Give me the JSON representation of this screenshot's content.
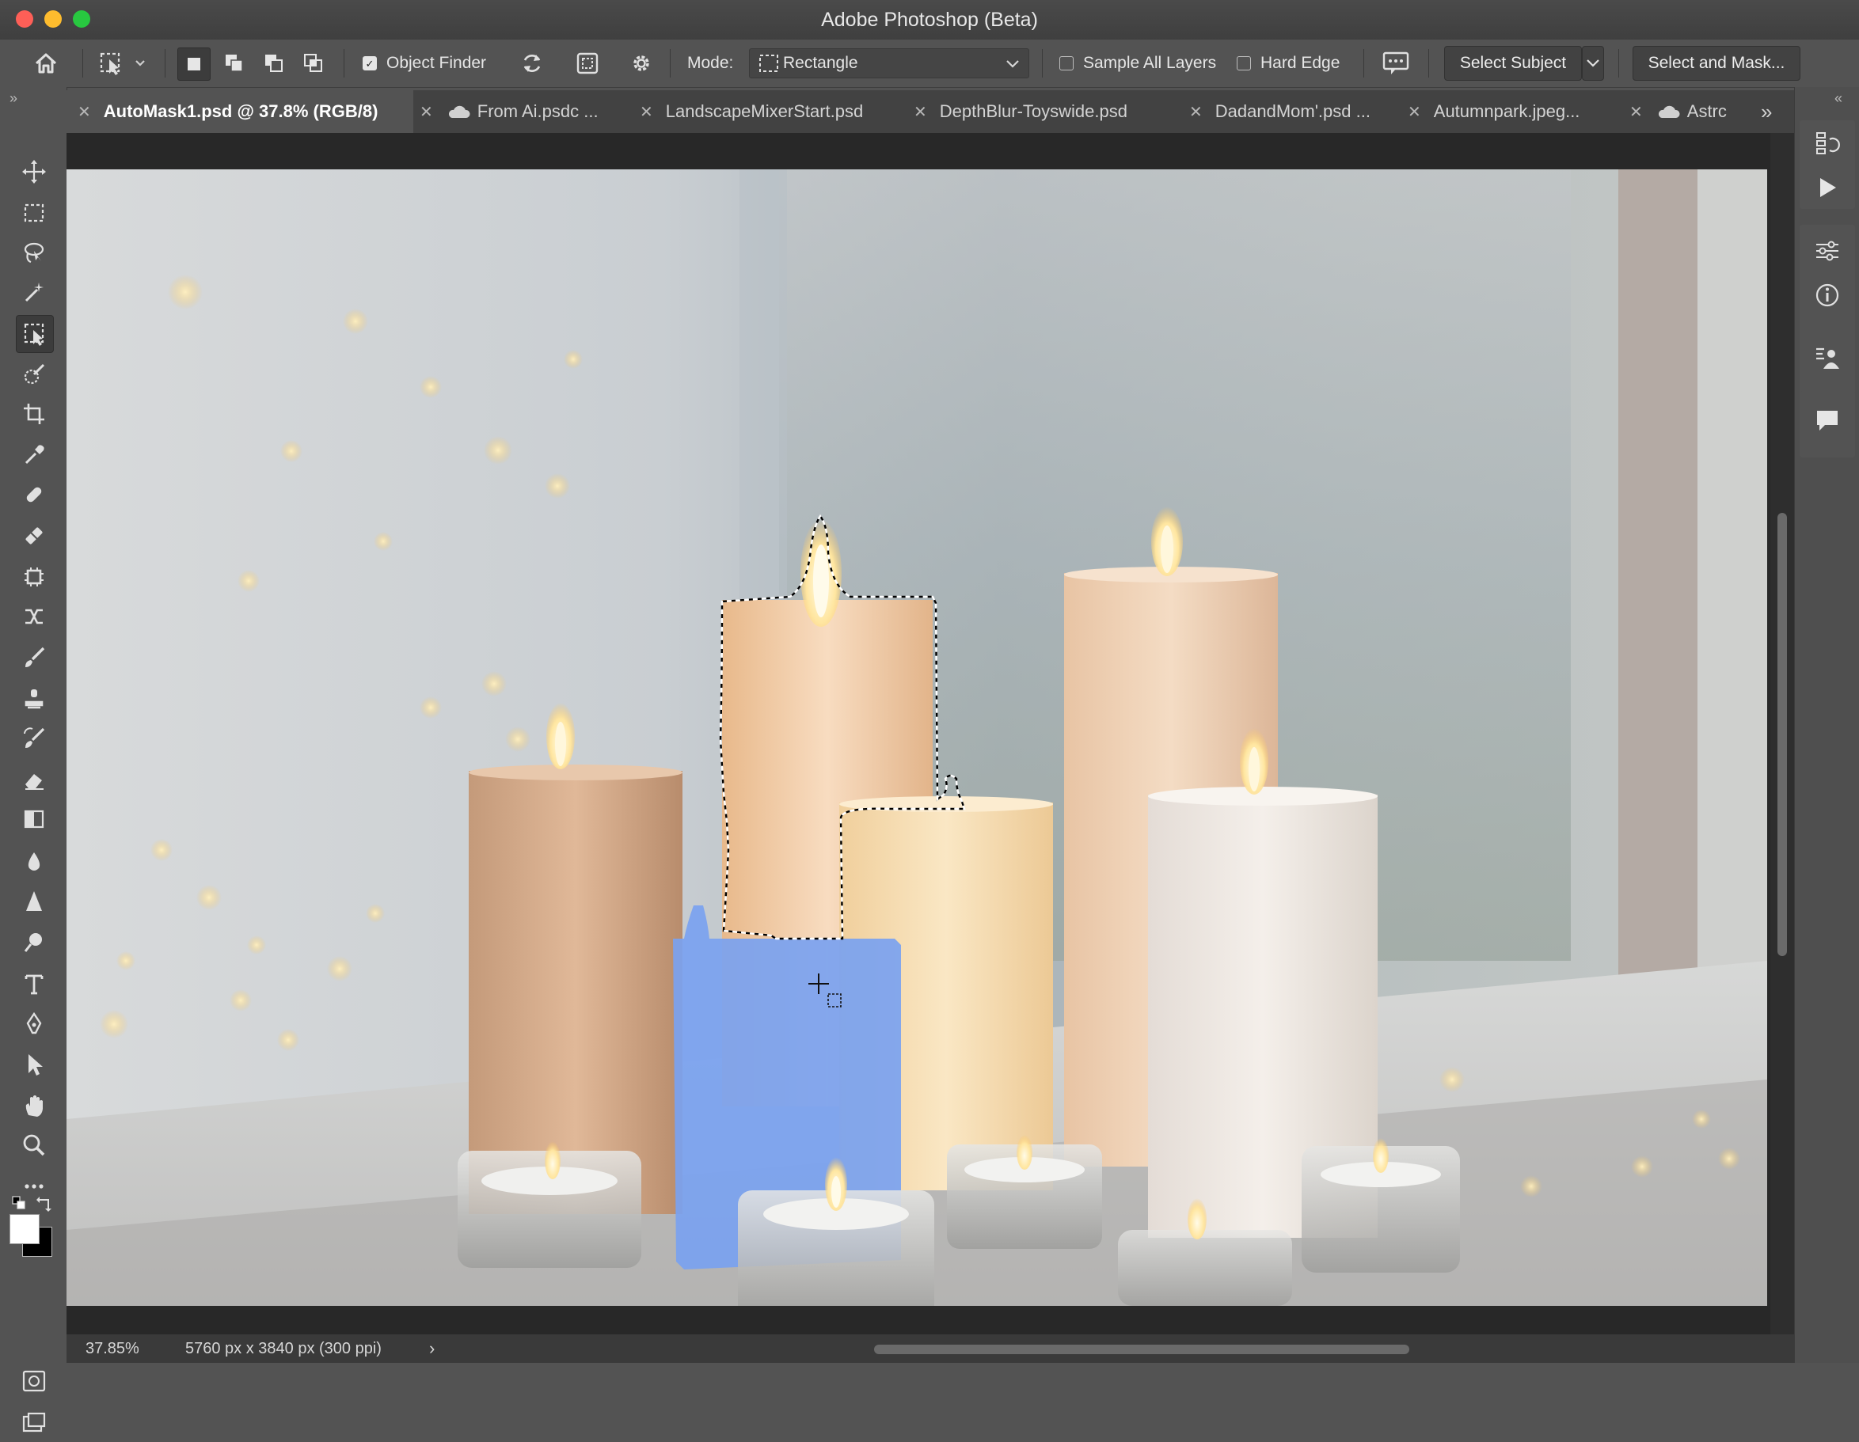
{
  "window": {
    "title": "Adobe Photoshop (Beta)"
  },
  "options_bar": {
    "object_finder_label": "Object Finder",
    "object_finder_checked": true,
    "mode_label": "Mode:",
    "mode_value": "Rectangle",
    "sample_all_layers_label": "Sample All Layers",
    "hard_edge_label": "Hard Edge",
    "select_subject_label": "Select Subject",
    "select_and_mask_label": "Select and Mask..."
  },
  "tabs": [
    {
      "label": "AutoMask1.psd @ 37.8% (RGB/8)",
      "active": true,
      "cloud": false
    },
    {
      "label": "From Ai.psdc ...",
      "active": false,
      "cloud": true
    },
    {
      "label": "LandscapeMixerStart.psd",
      "active": false,
      "cloud": false
    },
    {
      "label": "DepthBlur-Toyswide.psd",
      "active": false,
      "cloud": false
    },
    {
      "label": "DadandMom'.psd ...",
      "active": false,
      "cloud": false
    },
    {
      "label": "Autumnpark.jpeg...",
      "active": false,
      "cloud": false
    },
    {
      "label": "Astrc",
      "active": false,
      "cloud": true
    }
  ],
  "tools": [
    "move-tool",
    "marquee-tool",
    "lasso-tool",
    "magic-wand-tool",
    "object-selection-tool",
    "quick-selection-tool",
    "crop-tool",
    "eyedropper-tool",
    "spot-healing-tool",
    "healing-brush-tool",
    "patch-tool",
    "content-aware-move-tool",
    "brush-tool",
    "clone-stamp-tool",
    "history-brush-tool",
    "eraser-tool",
    "gradient-tool",
    "blur-tool",
    "sharpen-tool",
    "dodge-tool",
    "type-tool",
    "pen-tool",
    "path-selection-tool",
    "hand-tool",
    "zoom-tool",
    "more-tools"
  ],
  "colors": {
    "foreground": "#ffffff",
    "background": "#000000",
    "selection_overlay": "#7aa2f0"
  },
  "status": {
    "zoom": "37.85%",
    "doc_info": "5760 px x 3840 px (300 ppi)"
  }
}
